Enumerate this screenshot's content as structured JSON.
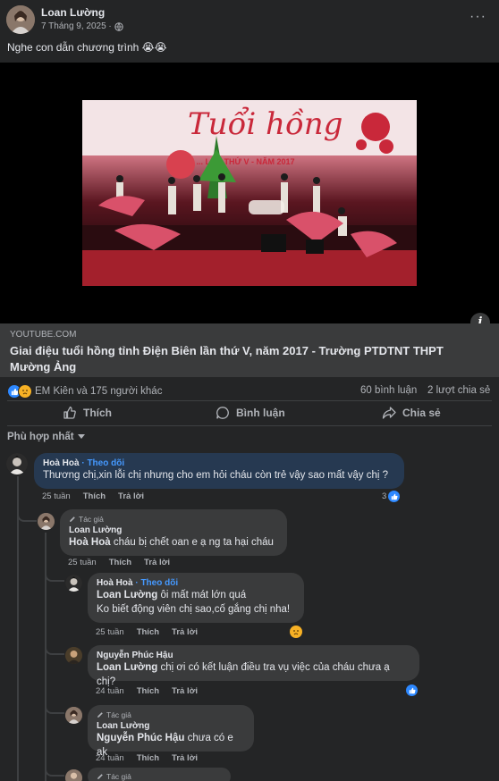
{
  "post": {
    "author": "Loan Lường",
    "date": "7 Tháng 9, 2025 ·",
    "text": "Nghe con dẫn chương trình 😭😭",
    "more": "···"
  },
  "video": {
    "banner_line1": "Tuổi hồng",
    "banner_line2": "TỈNH ... LẦN THỨ V - NĂM 2017"
  },
  "link": {
    "source": "YOUTUBE.COM",
    "title": "Giai điệu tuổi hồng tỉnh Điện Biên lần thứ V, năm 2017 - Trường PTDTNT THPT Mường Ảng"
  },
  "reactions": {
    "summary": "EM Kiên và 175 người khác",
    "comments": "60 bình luận",
    "shares": "2 lượt chia sẻ"
  },
  "actions": {
    "like": "Thích",
    "comment": "Bình luận",
    "share": "Chia sẻ"
  },
  "sort": "Phù hợp nhất",
  "comments": [
    {
      "name": "Hoà Hoà",
      "follow": "· Theo dõi",
      "text": "Thương chị,xin lỗi chị nhưng cho em hỏi cháu còn trẻ vậy sao mất vậy chị ?",
      "time": "25 tuần",
      "like": "Thích",
      "reply": "Trả lời",
      "reaction_count": "3"
    },
    {
      "tag": "Tác giả",
      "name": "Loan Lường",
      "mention": "Hoà Hoà",
      "text": " cháu bị chết oan e ạ ng ta hại cháu",
      "time": "25 tuần",
      "like": "Thích",
      "reply": "Trả lời"
    },
    {
      "name": "Hoà Hoà",
      "follow": "· Theo dõi",
      "mention": "Loan Lường",
      "text": " ôi mất mát lớn quá",
      "text2": "Ko biết động viên chị sao,cố gắng chị nha!",
      "time": "25 tuần",
      "like": "Thích",
      "reply": "Trả lời"
    },
    {
      "name": "Nguyễn Phúc Hậu",
      "mention": "Loan Lường",
      "text": " chị ơi có kết luận điều tra vụ việc của cháu chưa ạ chị?",
      "time": "24 tuần",
      "like": "Thích",
      "reply": "Trả lời"
    },
    {
      "tag": "Tác giả",
      "name": "Loan Lường",
      "mention": "Nguyễn Phúc Hậu",
      "text": " chưa có e ak",
      "time": "24 tuần",
      "like": "Thích",
      "reply": "Trả lời"
    },
    {
      "tag": "Tác giả"
    }
  ],
  "colors": {
    "background": "#242526",
    "accent": "#2d88ff",
    "link": "#4599ff"
  }
}
